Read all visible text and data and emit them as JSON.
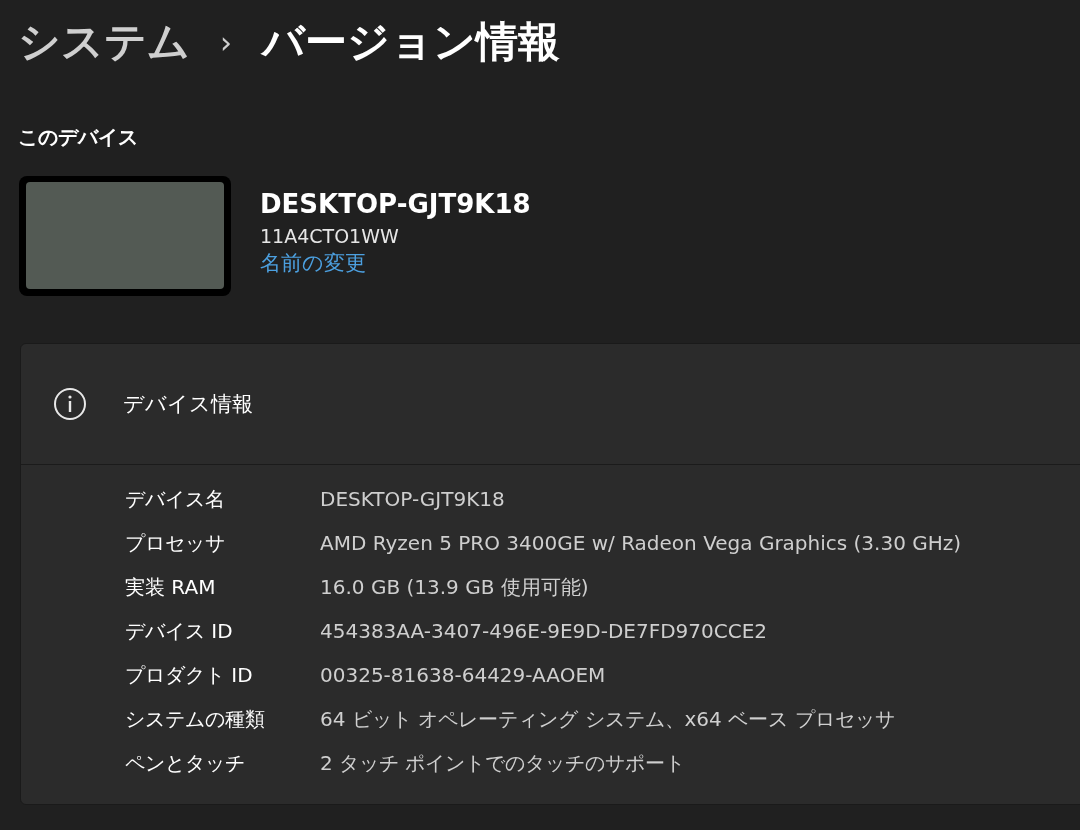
{
  "breadcrumb": {
    "parent": "システム",
    "separator": "›",
    "current": "バージョン情報"
  },
  "device_section": {
    "heading": "このデバイス",
    "name": "DESKTOP-GJT9K18",
    "model": "11A4CTO1WW",
    "rename_link": "名前の変更"
  },
  "device_info": {
    "title": "デバイス情報",
    "rows": [
      {
        "label": "デバイス名",
        "value": "DESKTOP-GJT9K18"
      },
      {
        "label": "プロセッサ",
        "value": "AMD Ryzen 5 PRO 3400GE w/ Radeon Vega Graphics (3.30 GHz)"
      },
      {
        "label": "実装 RAM",
        "value": "16.0 GB (13.9 GB 使用可能)"
      },
      {
        "label": "デバイス ID",
        "value": "454383AA-3407-496E-9E9D-DE7FD970CCE2"
      },
      {
        "label": "プロダクト ID",
        "value": "00325-81638-64429-AAOEM"
      },
      {
        "label": "システムの種類",
        "value": "64 ビット オペレーティング システム、x64 ベース プロセッサ"
      },
      {
        "label": "ペンとタッチ",
        "value": "2 タッチ ポイントでのタッチのサポート"
      }
    ]
  }
}
